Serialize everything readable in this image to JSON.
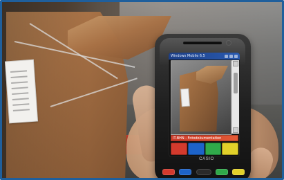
{
  "photo": {
    "device": {
      "brand": "CASIO",
      "screen": {
        "title": "Windows Mobile 6.5",
        "status_icons": [
          "signal-icon",
          "battery-icon",
          "close-icon"
        ],
        "app_banner": "IT-BHN - Fotodokumentation",
        "softkey_colors": [
          "#d33a2d",
          "#1d63c9",
          "#30a94a",
          "#e2d12a"
        ]
      },
      "hardware_key_colors": [
        "#d33a2d",
        "#1d63c9",
        "#2a2a2a",
        "#30a94a",
        "#e2d12a"
      ]
    }
  }
}
